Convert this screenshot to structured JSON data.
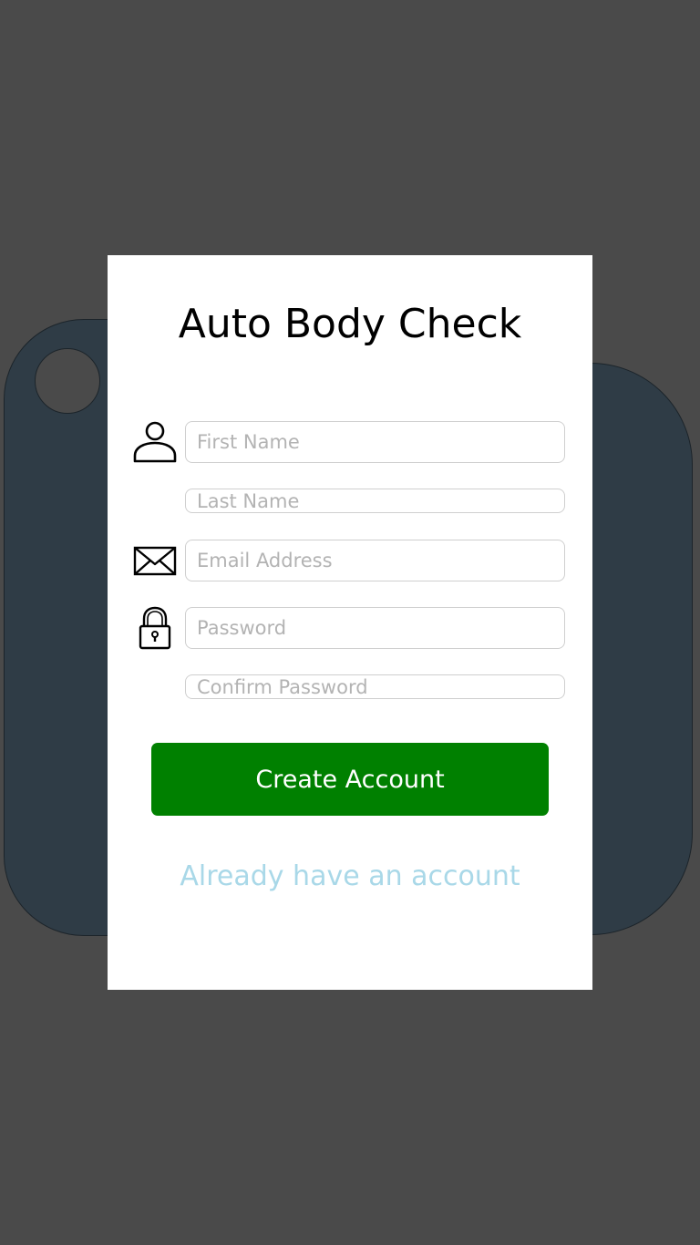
{
  "app": {
    "title": "Auto Body Check"
  },
  "form": {
    "first_name": {
      "placeholder": "First Name",
      "value": ""
    },
    "last_name": {
      "placeholder": "Last Name",
      "value": ""
    },
    "email": {
      "placeholder": "Email Address",
      "value": ""
    },
    "password": {
      "placeholder": "Password",
      "value": ""
    },
    "confirm_password": {
      "placeholder": "Confirm Password",
      "value": ""
    }
  },
  "icons": {
    "name": "user-icon",
    "email": "envelope-icon",
    "password": "lock-icon"
  },
  "actions": {
    "create_account_label": "Create Account",
    "login_link_label": "Already have an account"
  },
  "colors": {
    "background": "#4a4a4a",
    "illustration": "#2f3c46",
    "card": "#ffffff",
    "primary_button": "#008000",
    "link": "#a9d8e8",
    "placeholder": "#b3b3b3"
  }
}
